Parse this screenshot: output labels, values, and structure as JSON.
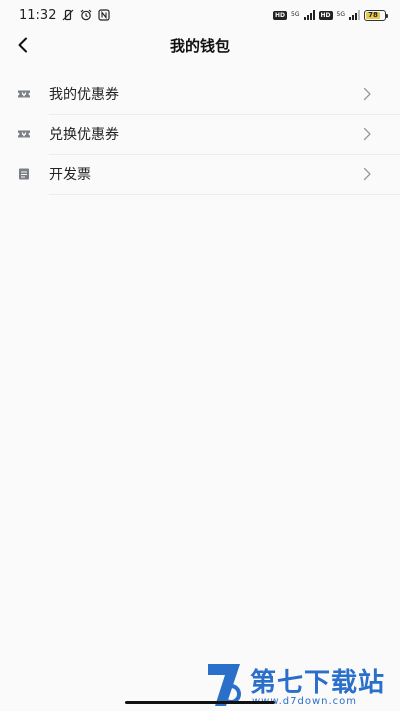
{
  "status_bar": {
    "time": "11:32",
    "network_type": "5G",
    "hd_label": "HD",
    "battery_level": "78",
    "battery_fraction": 0.78
  },
  "header": {
    "title": "我的钱包"
  },
  "menu": {
    "items": [
      {
        "label": "我的优惠券",
        "icon": "ticket-icon"
      },
      {
        "label": "兑换优惠券",
        "icon": "ticket-icon"
      },
      {
        "label": "开发票",
        "icon": "invoice-icon"
      }
    ]
  },
  "watermark": {
    "text": "第七下载站",
    "url": "www.d7down.com",
    "color": "#2a6fc9"
  }
}
